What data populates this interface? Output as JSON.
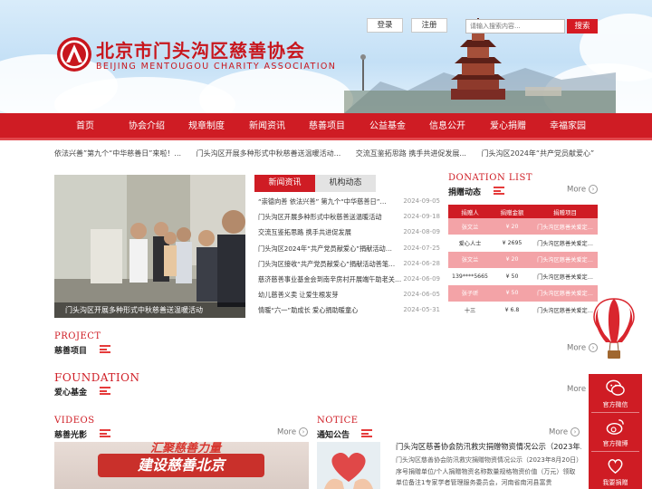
{
  "header": {
    "logo_cn": "北京市门头沟区慈善协会",
    "logo_en": "BEIJING MENTOUGOU CHARITY ASSOCIATION",
    "login_label": "登录",
    "register_label": "注册",
    "search": {
      "placeholder": "请输入搜索内容...",
      "button_label": "搜索"
    }
  },
  "nav": {
    "items": [
      "首页",
      "协会介绍",
      "规章制度",
      "新闻资讯",
      "慈善项目",
      "公益基金",
      "信息公开",
      "爱心捐赠",
      "幸福家园"
    ]
  },
  "ticker": {
    "items": [
      "依法兴善”第九个“中华慈善日”来啦！...",
      "门头沟区开展多种形式中秋慈善送温暖活动...",
      "交流互鉴拓思路 携手共进促发展...",
      "门头沟区2024年“共产党员献爱心”"
    ]
  },
  "news": {
    "slide_caption": "门头沟区开展多种形式中秋慈善送温暖活动",
    "tabs": [
      "新闻资讯",
      "机构动态"
    ],
    "items": [
      {
        "title": "“崇德向善 依法兴善” 第九个“中华慈善日”…",
        "date": "2024-09-05"
      },
      {
        "title": "门头沟区开展多种形式中秋慈善送温暖活动",
        "date": "2024-09-18"
      },
      {
        "title": "交流互鉴拓思路 携手共进促发展",
        "date": "2024-08-09"
      },
      {
        "title": "门头沟区2024年“共产党员献爱心”捐献活动…",
        "date": "2024-07-25"
      },
      {
        "title": "门头沟区接收“共产党员献爱心”捐献活动善笔…",
        "date": "2024-06-28"
      },
      {
        "title": "慈济慈善事业基金会到南辛房村开展端午助老关…",
        "date": "2024-06-09"
      },
      {
        "title": "幼儿慈善义卖 让爱生根发芽",
        "date": "2024-06-05"
      },
      {
        "title": "情暖“六一”助成长 爱心捐助暖童心",
        "date": "2024-05-31"
      }
    ]
  },
  "donations": {
    "title_en": "DONATION LIST",
    "title_cn": "捐赠动态",
    "more_label": "More",
    "columns": [
      "捐赠人",
      "捐赠金额",
      "捐赠项目"
    ],
    "rows": [
      {
        "donor": "张文兰",
        "amount": "¥ 20",
        "project": "门头沟区慈善关爱定…"
      },
      {
        "donor": "爱心人士",
        "amount": "¥ 2695",
        "project": "门头沟区慈善关爱定…"
      },
      {
        "donor": "张文兰",
        "amount": "¥ 20",
        "project": "门头沟区慈善关爱定…"
      },
      {
        "donor": "139****5665",
        "amount": "¥ 50",
        "project": "门头沟区慈善关爱定…"
      },
      {
        "donor": "张子昕",
        "amount": "¥ 50",
        "project": "门头沟区慈善关爱定…"
      },
      {
        "donor": "十三",
        "amount": "¥ 6.8",
        "project": "门头沟区慈善关爱定…"
      }
    ]
  },
  "project": {
    "title_en": "PROJECT",
    "title_cn": "慈善项目",
    "more_label": "More"
  },
  "foundation": {
    "title_en": "FOUNDATION",
    "title_cn": "爱心基金",
    "more_label": "More"
  },
  "videos": {
    "title_en": "VIDEOS",
    "title_cn": "慈善光影",
    "more_label": "More",
    "banner_text": "建设慈善北京",
    "banner_top_text": "汇聚慈善力量"
  },
  "notice": {
    "title_en": "NOTICE",
    "title_cn": "通知公告",
    "more_label": "More",
    "item_title": "门头沟区慈善协会防汛救灾捐赠物资情况公示（2023年…",
    "item_text": "门头沟区慈善协会防汛救灾捐赠物资情况公示（2023年8月20日）序号捐赠单位/个人捐赠物资名称数量规格物资价值（万元）领取单位备注1专家学者管理服务委员会，河南省南河县富贵"
  },
  "float": {
    "items": [
      "官方微信",
      "官方微博",
      "我要捐赠"
    ]
  },
  "colors": {
    "brand_red": "#cf1c24",
    "pink_row": "#f3a3a7"
  }
}
